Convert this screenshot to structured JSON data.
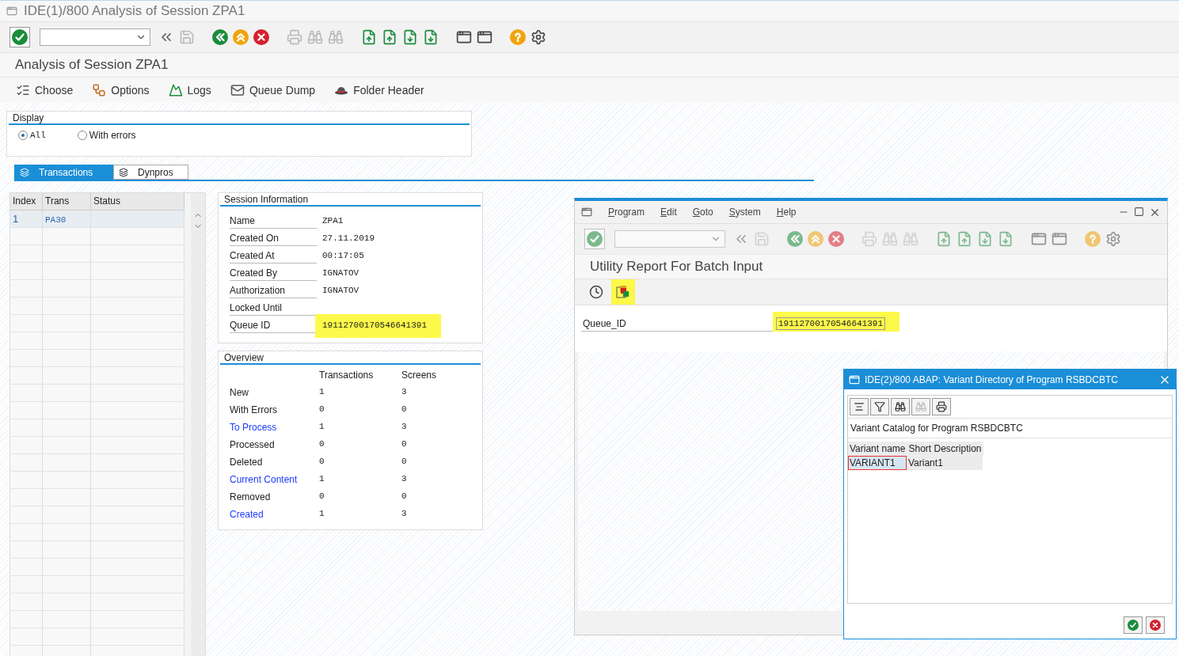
{
  "window": {
    "title": "IDE(1)/800 Analysis of Session ZPA1"
  },
  "page_title": "Analysis of Session ZPA1",
  "app_toolbar": [
    {
      "kind": "choose",
      "label": "Choose"
    },
    {
      "kind": "options",
      "label": "Options"
    },
    {
      "kind": "logs",
      "label": "Logs"
    },
    {
      "kind": "dump",
      "label": "Queue Dump"
    },
    {
      "kind": "folder",
      "label": "Folder Header"
    }
  ],
  "display": {
    "title": "Display",
    "options": [
      {
        "label": "All",
        "selected": true
      },
      {
        "label": "With errors",
        "selected": false
      }
    ]
  },
  "tabs": [
    {
      "label": "Transactions",
      "selected": true
    },
    {
      "label": "Dynpros",
      "selected": false
    }
  ],
  "transactions_table": {
    "columns": [
      "Index",
      "Trans",
      "Status"
    ],
    "rows": [
      {
        "index": "1",
        "trans": "PA30"
      }
    ]
  },
  "session_info": {
    "title": "Session Information",
    "fields": [
      {
        "label": "Name",
        "value": "ZPA1",
        "highlighted": false
      },
      {
        "label": "Created On",
        "value": "27.11.2019",
        "highlighted": false
      },
      {
        "label": "Created At",
        "value": "00:17:05",
        "highlighted": false
      },
      {
        "label": "Created By",
        "value": "IGNATOV",
        "highlighted": false
      },
      {
        "label": "Authorization",
        "value": "IGNATOV",
        "highlighted": false
      },
      {
        "label": "Locked Until",
        "highlighted": false
      },
      {
        "label": "Queue ID",
        "value": "19112700170546641391",
        "highlighted": true
      }
    ]
  },
  "overview": {
    "title": "Overview",
    "columns": [
      "Transactions",
      "Screens"
    ],
    "rows": [
      {
        "label": "New",
        "link": false,
        "transactions": "1",
        "screens": "3"
      },
      {
        "label": "With Errors",
        "link": false,
        "transactions": "0",
        "screens": "0"
      },
      {
        "label": "To Process",
        "link": true,
        "transactions": "1",
        "screens": "3"
      },
      {
        "label": "Processed",
        "link": false,
        "transactions": "0",
        "screens": "0"
      },
      {
        "label": "Deleted",
        "link": false,
        "transactions": "0",
        "screens": "0"
      },
      {
        "label": "Current Content",
        "link": true,
        "transactions": "1",
        "screens": "3"
      },
      {
        "label": "Removed",
        "link": false,
        "transactions": "0",
        "screens": "0"
      },
      {
        "label": "Created",
        "link": true,
        "transactions": "1",
        "screens": "3"
      }
    ]
  },
  "dialog": {
    "menu": [
      "Program",
      "Edit",
      "Goto",
      "System",
      "Help"
    ],
    "title": "Utility Report For Batch Input",
    "field": {
      "label": "Queue_ID",
      "value": "19112700170546641391",
      "highlighted": true
    }
  },
  "popup": {
    "title": "IDE(2)/800 ABAP: Variant Directory of Program RSBDCBTC",
    "subtitle": "Variant Catalog for Program RSBDCBTC",
    "columns": [
      "Variant name",
      "Short Description"
    ],
    "rows": [
      {
        "name": "VARIANT1",
        "description": "Variant1",
        "selected": true
      }
    ]
  }
}
